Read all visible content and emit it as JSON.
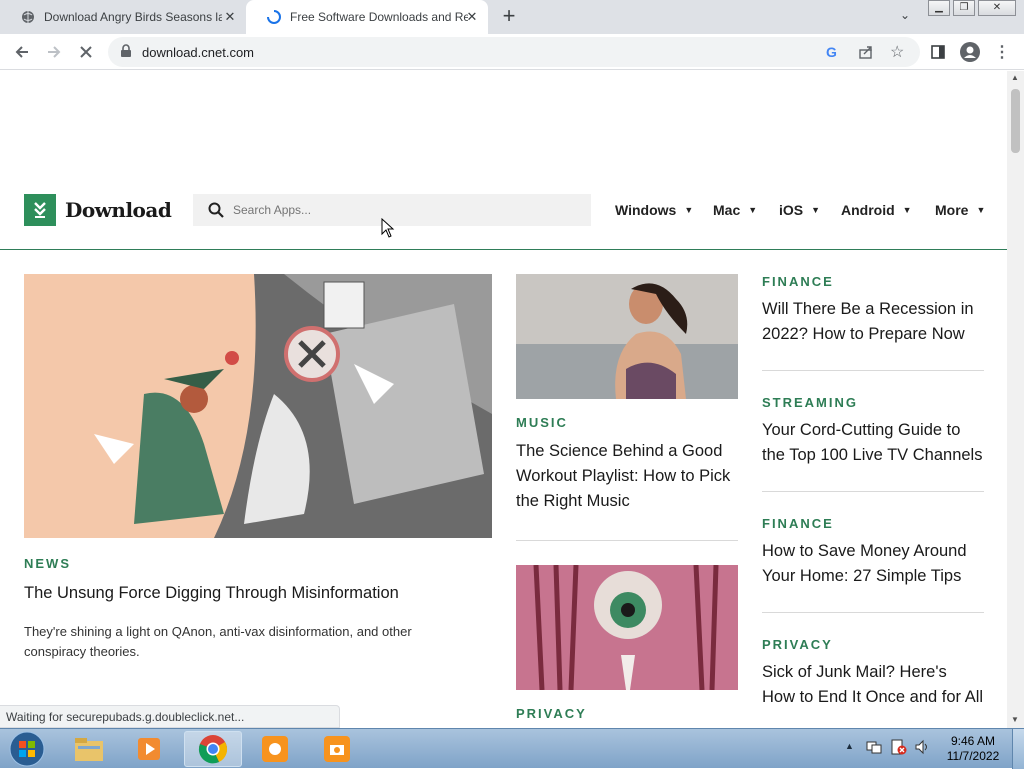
{
  "browser": {
    "tabs": [
      {
        "title": "Download Angry Birds Seasons la",
        "active": false
      },
      {
        "title": "Free Software Downloads and Re",
        "active": true
      }
    ],
    "url": "download.cnet.com",
    "status_text": "Waiting for securepubads.g.doubleclick.net..."
  },
  "site": {
    "logo_text": "Download",
    "search_placeholder": "Search Apps...",
    "nav": [
      "Windows",
      "Mac",
      "iOS",
      "Android",
      "More"
    ]
  },
  "articles": {
    "lead": {
      "kicker": "NEWS",
      "headline": "The Unsung Force Digging Through Misinformation",
      "dek": "They're shining a light on QAnon, anti-vax disinformation, and other conspiracy theories."
    },
    "middle": [
      {
        "kicker": "MUSIC",
        "headline": "The Science Behind a Good Workout Playlist: How to Pick the Right Music"
      },
      {
        "kicker": "PRIVACY",
        "headline": ""
      }
    ],
    "right": [
      {
        "kicker": "FINANCE",
        "headline": "Will There Be a Recession in 2022? How to Prepare Now"
      },
      {
        "kicker": "STREAMING",
        "headline": "Your Cord-Cutting Guide to the Top 100 Live TV Channels"
      },
      {
        "kicker": "FINANCE",
        "headline": "How to Save Money Around Your Home: 27 Simple Tips"
      },
      {
        "kicker": "PRIVACY",
        "headline": "Sick of Junk Mail? Here's How to End It Once and for All"
      }
    ]
  },
  "taskbar": {
    "time": "9:46 AM",
    "date": "11/7/2022"
  },
  "colors": {
    "brand_green": "#2e8f5b",
    "kicker_green": "#2e7d55"
  }
}
